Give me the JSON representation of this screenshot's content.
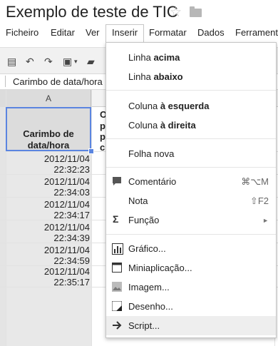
{
  "doc": {
    "title": "Exemplo de teste de TIC"
  },
  "menubar": [
    "Ficheiro",
    "Editar",
    "Ver",
    "Inserir",
    "Formatar",
    "Dados",
    "Ferramentas"
  ],
  "formula": "Carimbo de data/hora",
  "grid": {
    "col_a": "A",
    "header_line1": "Carimbo de",
    "header_line2": "data/hora",
    "b_fragments": [
      "O",
      "p",
      "p",
      "c"
    ],
    "rows": [
      {
        "date": "2012/11/04",
        "time": "22:32:23"
      },
      {
        "date": "2012/11/04",
        "time": "22:34:03"
      },
      {
        "date": "2012/11/04",
        "time": "22:34:17"
      },
      {
        "date": "2012/11/04",
        "time": "22:34:39"
      },
      {
        "date": "2012/11/04",
        "time": "22:34:59"
      },
      {
        "date": "2012/11/04",
        "time": "22:35:17"
      }
    ]
  },
  "insert_menu": {
    "linha_prefix": "Linha",
    "acima": "acima",
    "abaixo": "abaixo",
    "coluna_prefix": "Coluna",
    "esquerda": "à esquerda",
    "direita": "à direita",
    "folha_nova": "Folha nova",
    "comentario": "Comentário",
    "comentario_shortcut": "⌘⌥M",
    "nota": "Nota",
    "nota_shortcut": "⇧F2",
    "funcao": "Função",
    "grafico": "Gráfico...",
    "miniaplicacao": "Miniaplicação...",
    "imagem": "Imagem...",
    "desenho": "Desenho...",
    "script": "Script..."
  }
}
